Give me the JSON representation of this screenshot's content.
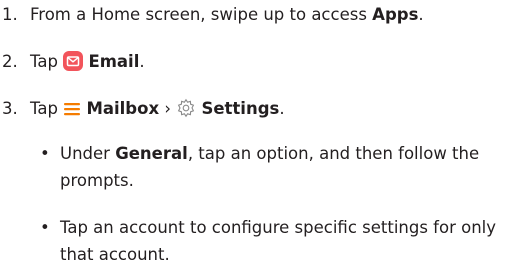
{
  "steps": [
    {
      "number": "1.",
      "text_before": "From a Home screen, swipe up to access ",
      "bold": "Apps",
      "text_after": "."
    },
    {
      "number": "2.",
      "text_before": "Tap ",
      "bold": "Email",
      "text_after": ".",
      "icon": "email-app-icon"
    },
    {
      "number": "3.",
      "text_before": "Tap ",
      "bold_1": "Mailbox",
      "separator": " › ",
      "bold_2": "Settings",
      "text_after": ".",
      "icon_1": "menu-icon",
      "icon_2": "settings-gear-icon"
    }
  ],
  "bullets": [
    {
      "text_before": "Under ",
      "bold": "General",
      "text_after": ", tap an option, and then follow the prompts."
    },
    {
      "text": "Tap an account to configure specific settings for only that account."
    }
  ],
  "colors": {
    "text": "#231f20",
    "email_icon": "#f2545b",
    "menu_icon": "#f57c00",
    "gear_icon": "#8a8a8a"
  }
}
